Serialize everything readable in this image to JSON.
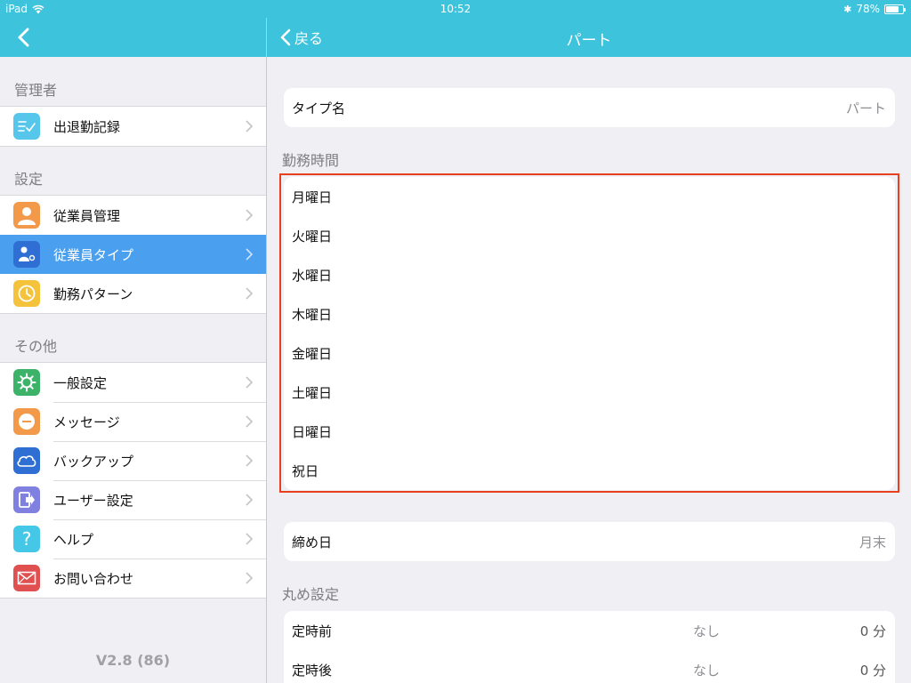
{
  "status_bar": {
    "device": "iPad",
    "time": "10:52",
    "battery": "78%",
    "battery_level": 0.78
  },
  "sidebar": {
    "sections": [
      {
        "header": "管理者",
        "items": [
          {
            "label": "出退勤記録",
            "icon": "attendance-icon",
            "color": "#56c6ea"
          }
        ]
      },
      {
        "header": "設定",
        "items": [
          {
            "label": "従業員管理",
            "icon": "person-icon",
            "color": "#f2994a"
          },
          {
            "label": "従業員タイプ",
            "icon": "person-type-icon",
            "color": "#2f6fd3",
            "active": true
          },
          {
            "label": "勤務パターン",
            "icon": "clock-icon",
            "color": "#f5c33b"
          }
        ]
      },
      {
        "header": "その他",
        "items": [
          {
            "label": "一般設定",
            "icon": "gear-icon",
            "color": "#3db36a"
          },
          {
            "label": "メッセージ",
            "icon": "message-icon",
            "color": "#f2994a"
          },
          {
            "label": "バックアップ",
            "icon": "cloud-icon",
            "color": "#2f6fd3"
          },
          {
            "label": "ユーザー設定",
            "icon": "logout-icon",
            "color": "#8080e0"
          },
          {
            "label": "ヘルプ",
            "icon": "help-icon",
            "color": "#45c8e8"
          },
          {
            "label": "お問い合わせ",
            "icon": "mail-icon",
            "color": "#e05050"
          }
        ]
      }
    ],
    "version": "V2.8 (86)"
  },
  "main": {
    "back_label": "戻る",
    "title": "パート",
    "type_name": {
      "label": "タイプ名",
      "value": "パート"
    },
    "work_hours_header": "勤務時間",
    "days": [
      "月曜日",
      "火曜日",
      "水曜日",
      "木曜日",
      "金曜日",
      "土曜日",
      "日曜日",
      "祝日"
    ],
    "closing_day": {
      "label": "締め日",
      "value": "月末"
    },
    "rounding_header": "丸め設定",
    "rounding": [
      {
        "label": "定時前",
        "setting": "なし",
        "value": "0 分"
      },
      {
        "label": "定時後",
        "setting": "なし",
        "value": "0 分"
      }
    ]
  },
  "colors": {
    "accent": "#3ec3dc",
    "active_row": "#4aa0ee",
    "highlight_border": "#e8401e"
  }
}
